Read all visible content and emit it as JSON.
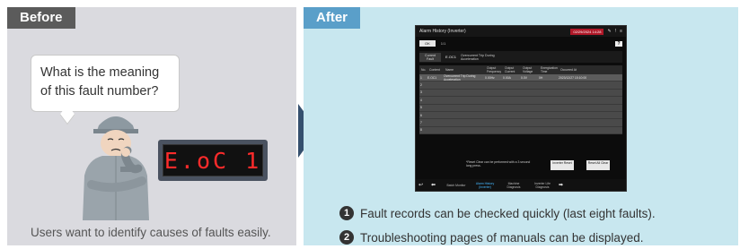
{
  "before": {
    "tag": "Before",
    "bubble_line1": "What is the meaning",
    "bubble_line2": "of this fault number?",
    "fault_display": "E.oC 1",
    "caption": "Users want to identify causes of faults easily."
  },
  "after": {
    "tag": "After",
    "screen": {
      "title": "Alarm History (Inverter)",
      "date": "02/29/2024 14:28",
      "nav_button": "OK",
      "page": "1/1",
      "help_icon": "?",
      "fault_label": "Current Fault",
      "fault_code": "E.OC1",
      "fault_desc": "Overcurrent Trip During Acceleration",
      "headers": [
        "No.",
        "Content",
        "Name",
        "Output Frequency",
        "Output Current",
        "Output Voltage",
        "Energization Time",
        "Occurred At"
      ],
      "row1": {
        "num": "1",
        "code": "E.OC1",
        "name": "Overcurrent Trip During Acceleration",
        "freq": "0.00Hz",
        "curr": "0.00A",
        "volt": "0.0V",
        "time": "0H",
        "date": "2023/12/27 15:10:00"
      },
      "row_nums": [
        "1",
        "2",
        "3",
        "4",
        "5",
        "6",
        "7",
        "8"
      ],
      "note": "*Reset Clear can be performed with a 3 second long press.",
      "reset_btn": "Inverter Reset",
      "clear_btn": "Reset All Clear",
      "tabs": [
        "Batch Monitor",
        "Alarm History (Inverter)",
        "Machine Diagnosis",
        "Inverter Life Diagnosis"
      ],
      "back_icon": "↩"
    },
    "feature1": "Fault records can be checked quickly (last eight faults).",
    "feature2": "Troubleshooting pages of manuals can be displayed.",
    "feature1_num": "1",
    "feature2_num": "2"
  },
  "colors": {
    "before_tag": "#5b5b5b",
    "after_tag": "#5a9fc9",
    "arrow": "#35506e",
    "fault_text": "#ff2b2b",
    "left_bg": "#dadadf",
    "right_bg": "#c8e7ef"
  }
}
